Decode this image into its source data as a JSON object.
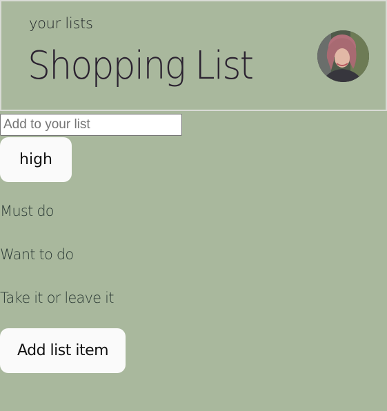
{
  "header": {
    "subtitle": "your lists",
    "title": "Shopping List",
    "avatar_icon": "user-avatar-photo"
  },
  "form": {
    "input_placeholder": "Add to your list",
    "input_value": "",
    "priority_label": "high",
    "priority_options": [
      "Must do",
      "Want to do",
      "Take it or leave it"
    ],
    "add_button_label": "Add list item"
  },
  "colors": {
    "background": "#a9b89d",
    "button_background": "#fafafa",
    "header_border": "#d9dbd6",
    "title_text": "#2b2230",
    "option_text": "#2b3a35"
  }
}
